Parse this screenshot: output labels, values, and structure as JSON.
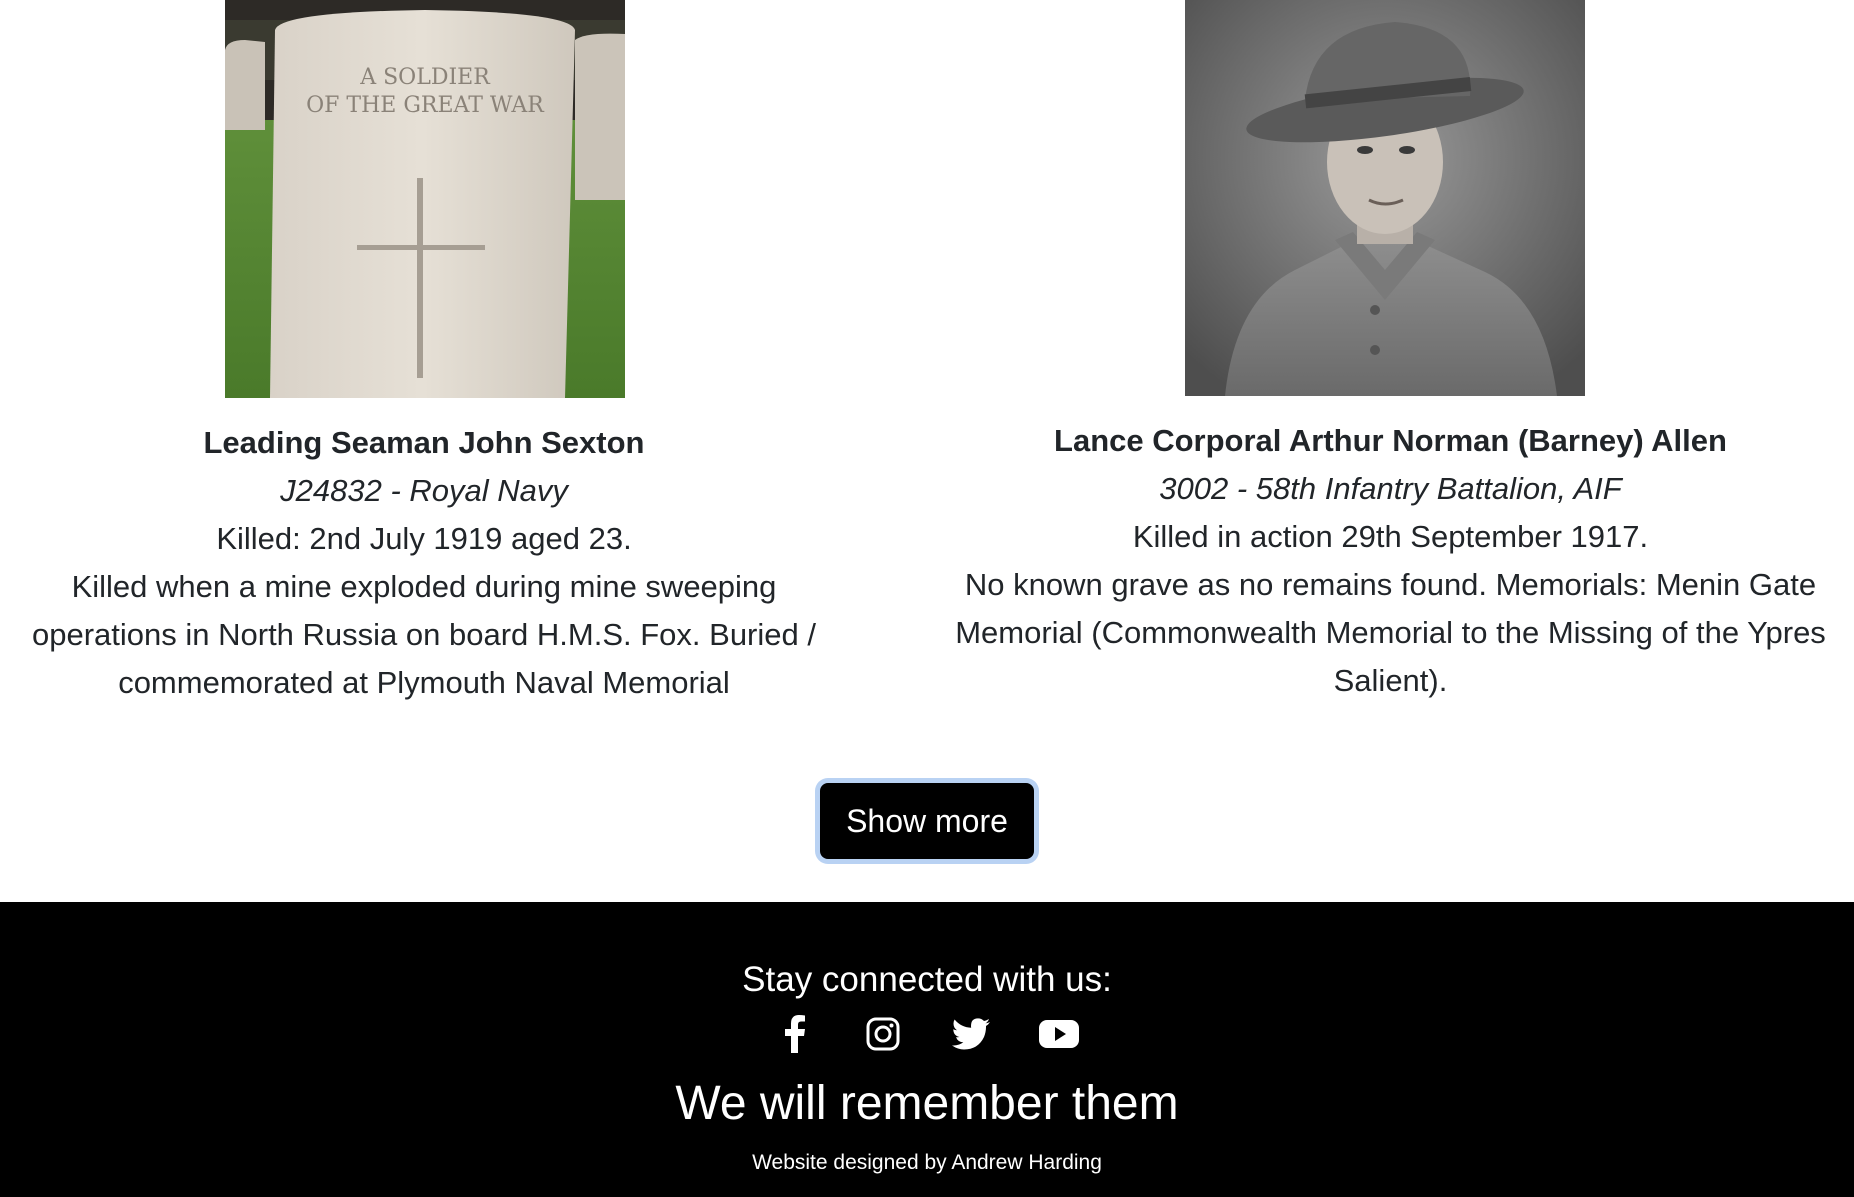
{
  "cards": [
    {
      "name": "Leading Seaman John Sexton",
      "service": "J24832 - Royal Navy",
      "killed": "Killed: 2nd July 1919 aged 23.",
      "description": "Killed when a mine exploded during mine sweeping operations in North Russia on board H.M.S. Fox. Buried / commemorated at Plymouth Naval Memorial",
      "headstone_text_line1": "A SOLDIER",
      "headstone_text_line2": "OF THE GREAT WAR"
    },
    {
      "name": "Lance Corporal Arthur Norman (Barney) Allen",
      "service": "3002 - 58th Infantry Battalion, AIF",
      "killed": "Killed in action 29th September 1917.",
      "description": "No known grave as no remains found. Memorials: Menin Gate Memorial (Commonwealth Memorial to the Missing of the Ypres Salient)."
    }
  ],
  "show_more_label": "Show more",
  "footer": {
    "stay_connected": "Stay connected with us:",
    "social_icons": [
      "facebook-icon",
      "instagram-icon",
      "twitter-icon",
      "youtube-icon"
    ],
    "tagline": "We will remember them",
    "credit": "Website designed by Andrew Harding"
  },
  "colors": {
    "footer_bg": "#000000",
    "button_bg": "#000000",
    "button_focus_ring": "#b9d2f3",
    "text": "#212529"
  }
}
